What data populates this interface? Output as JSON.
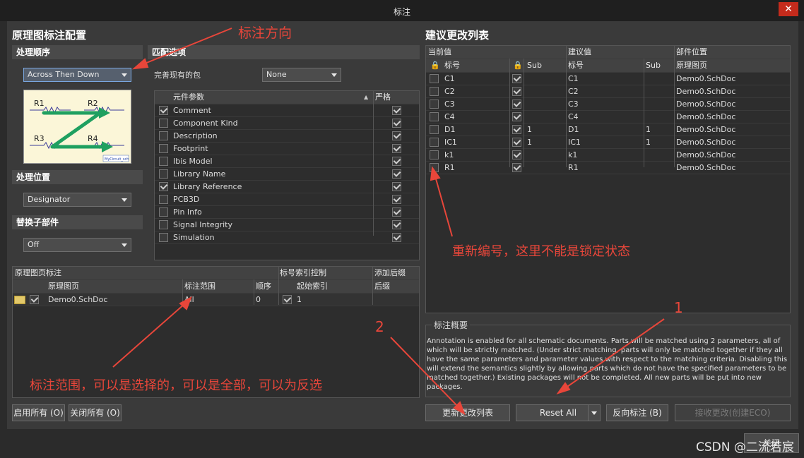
{
  "window": {
    "title": "标注",
    "close_glyph": "✕"
  },
  "left": {
    "title": "原理图标注配置",
    "order": {
      "header": "处理顺序",
      "selected": "Across Then Down"
    },
    "preview": {
      "labels": [
        "R1",
        "R2",
        "R3",
        "R4"
      ],
      "caption": "MyCircuit_sch"
    },
    "location": {
      "header": "处理位置",
      "selected": "Designator"
    },
    "replace": {
      "header": "替换子部件",
      "selected": "Off"
    }
  },
  "match": {
    "header": "匹配选项",
    "complete_label": "完善现有的包",
    "complete_value": "None",
    "col_param": "元件参数",
    "col_strict": "严格",
    "rows": [
      {
        "name": "Comment",
        "checked": true,
        "strict": true
      },
      {
        "name": "Component Kind",
        "checked": false,
        "strict": true
      },
      {
        "name": "Description",
        "checked": false,
        "strict": true
      },
      {
        "name": "Footprint",
        "checked": false,
        "strict": true
      },
      {
        "name": "Ibis Model",
        "checked": false,
        "strict": true
      },
      {
        "name": "Library Name",
        "checked": false,
        "strict": true
      },
      {
        "name": "Library Reference",
        "checked": true,
        "strict": true
      },
      {
        "name": "PCB3D",
        "checked": false,
        "strict": true
      },
      {
        "name": "Pin Info",
        "checked": false,
        "strict": true
      },
      {
        "name": "Signal Integrity",
        "checked": false,
        "strict": true
      },
      {
        "name": "Simulation",
        "checked": false,
        "strict": true
      }
    ]
  },
  "sheets": {
    "group1": "原理图页标注",
    "group2": "标号索引控制",
    "group3": "添加后缀",
    "col_sheet": "原理图页",
    "col_scope": "标注范围",
    "col_order": "顺序",
    "col_start": "起始索引",
    "col_suffix": "后缀",
    "row": {
      "sheet": "Demo0.SchDoc",
      "scope": "All",
      "order": "0",
      "start": "1"
    }
  },
  "buttons_left": {
    "enable_all": "启用所有 (O)",
    "disable_all": "关闭所有 (O)"
  },
  "changes": {
    "title": "建议更改列表",
    "group_current": "当前值",
    "group_proposed": "建议值",
    "group_location": "部件位置",
    "col_designator": "标号",
    "col_sub": "Sub",
    "col_sheet": "原理图页",
    "rows": [
      {
        "cur": "C1",
        "sub": "",
        "new": "C1",
        "nsub": "",
        "doc": "Demo0.SchDoc"
      },
      {
        "cur": "C2",
        "sub": "",
        "new": "C2",
        "nsub": "",
        "doc": "Demo0.SchDoc"
      },
      {
        "cur": "C3",
        "sub": "",
        "new": "C3",
        "nsub": "",
        "doc": "Demo0.SchDoc"
      },
      {
        "cur": "C4",
        "sub": "",
        "new": "C4",
        "nsub": "",
        "doc": "Demo0.SchDoc"
      },
      {
        "cur": "D1",
        "sub": "1",
        "new": "D1",
        "nsub": "1",
        "doc": "Demo0.SchDoc"
      },
      {
        "cur": "IC1",
        "sub": "1",
        "new": "IC1",
        "nsub": "1",
        "doc": "Demo0.SchDoc"
      },
      {
        "cur": "k1",
        "sub": "",
        "new": "k1",
        "nsub": "",
        "doc": "Demo0.SchDoc"
      },
      {
        "cur": "R1",
        "sub": "",
        "new": "R1",
        "nsub": "",
        "doc": "Demo0.SchDoc"
      }
    ]
  },
  "summary": {
    "header": "标注概要",
    "text": "Annotation is enabled for all schematic documents. Parts will be matched using 2 parameters, all of which will be strictly matched. (Under strict matching, parts will only be matched together if they all have the same parameters and parameter values with respect to the matching criteria. Disabling this will extend the semantics slightly by allowing parts which do not have the specified parameters to be matched together.) Existing packages will not be completed. All new parts will be put into new packages."
  },
  "buttons_right": {
    "update": "更新更改列表",
    "reset": "Reset All",
    "back": "反向标注 (B)",
    "accept": "接收更改(创建ECO)",
    "close": "关闭"
  },
  "annotations": {
    "direction": "标注方向",
    "renumber": "重新编号，这里不能是锁定状态",
    "scope": "标注范围，可以是选择的，可以是全部，可以为反选",
    "n1": "1",
    "n2": "2"
  },
  "watermark": "CSDN @二流若宸"
}
